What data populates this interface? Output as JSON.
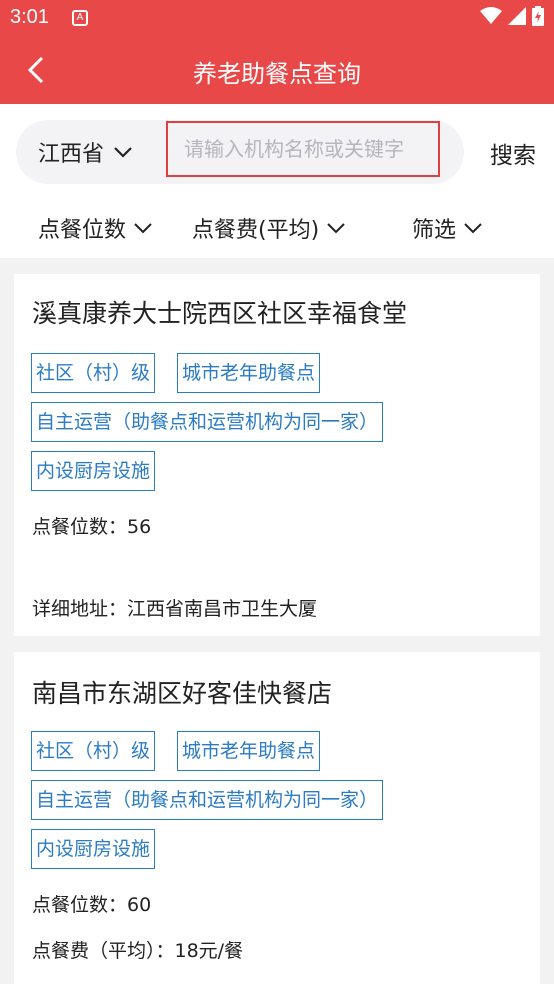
{
  "status_bar": {
    "time": "3:01",
    "notification_glyph": "A"
  },
  "header": {
    "title": "养老助餐点查询"
  },
  "search": {
    "province": "江西省",
    "placeholder": "请输入机构名称或关键字",
    "button_label": "搜索"
  },
  "filters": [
    {
      "label": "点餐位数"
    },
    {
      "label": "点餐费(平均)"
    },
    {
      "label": "筛选"
    }
  ],
  "results": [
    {
      "name": "溪真康养大士院西区社区幸福食堂",
      "tags": [
        "社区（村）级",
        "城市老年助餐点",
        "自主运营（助餐点和运营机构为同一家）",
        "内设厨房设施"
      ],
      "seats_line": "点餐位数：56",
      "address_line": "详细地址：江西省南昌市卫生大厦"
    },
    {
      "name": "南昌市东湖区好客佳快餐店",
      "tags": [
        "社区（村）级",
        "城市老年助餐点",
        "自主运营（助餐点和运营机构为同一家）",
        "内设厨房设施"
      ],
      "seats_line": "点餐位数：60",
      "fee_line": "点餐费（平均）：18元/餐"
    }
  ],
  "colors": {
    "header_bg": "#e84848",
    "tag_blue": "#2b7cc5",
    "input_border": "#e04040"
  }
}
